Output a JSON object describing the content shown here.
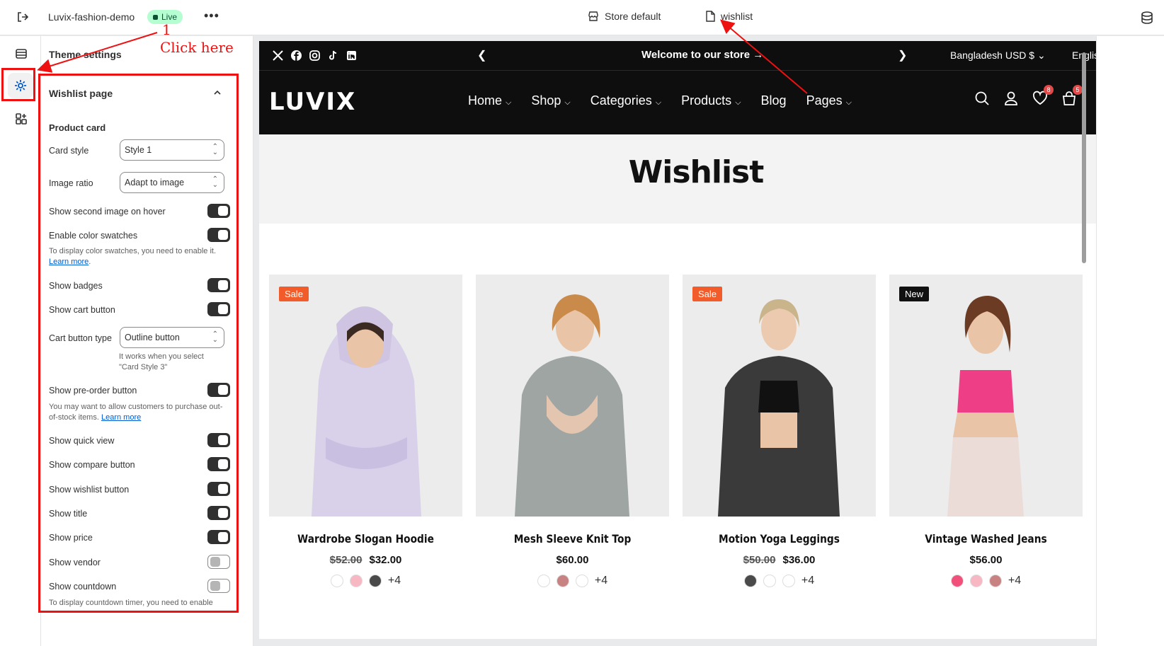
{
  "topbar": {
    "store_name": "Luvix-fashion-demo",
    "status_badge": "Live",
    "more_label": "•••",
    "theme_label": "Store default",
    "template_label": "wishlist"
  },
  "panel": {
    "title": "Theme settings",
    "section_title": "Wishlist page",
    "subsection_title": "Product card",
    "fields": [
      {
        "label": "Card style",
        "value": "Style 1"
      },
      {
        "label": "Image ratio",
        "value": "Adapt to image"
      },
      {
        "label": "Cart button type",
        "value": "Outline button"
      }
    ],
    "toggles": [
      {
        "label": "Show second image on hover",
        "on": true
      },
      {
        "label": "Enable color swatches",
        "on": true
      },
      {
        "label": "Show badges",
        "on": true
      },
      {
        "label": "Show cart button",
        "on": true
      },
      {
        "label": "Show pre-order button",
        "on": true
      },
      {
        "label": "Show quick view",
        "on": true
      },
      {
        "label": "Show compare button",
        "on": true
      },
      {
        "label": "Show wishlist button",
        "on": true
      },
      {
        "label": "Show title",
        "on": true
      },
      {
        "label": "Show price",
        "on": true
      },
      {
        "label": "Show vendor",
        "on": false
      },
      {
        "label": "Show countdown",
        "on": false
      }
    ],
    "help": {
      "swatches": "To display color swatches, you need to enable it.",
      "learn_more": "Learn more",
      "cart_type": "It works when you select \"Card Style 3\"",
      "preorder": "You may want to allow customers to purchase out-of-stock items.",
      "countdown": "To display countdown timer, you need to enable"
    }
  },
  "annotation": {
    "step_number": "1",
    "click_text": "Click here"
  },
  "store": {
    "announcement": "Welcome to our store →",
    "currency": "Bangladesh USD $ ⌄",
    "language": "English ⌄",
    "logo": "LUVIX",
    "nav": [
      "Home",
      "Shop",
      "Categories",
      "Products",
      "Blog",
      "Pages"
    ],
    "wishlist_count": "8",
    "cart_count": "5",
    "page_title": "Wishlist",
    "products": [
      {
        "name": "Wardrobe Slogan Hoodie",
        "compare_price": "$52.00",
        "price": "$32.00",
        "tag": "Sale",
        "tag_color": "#f25c2b",
        "swatches": [
          "#ffffff",
          "#f7b7c3",
          "#4a4a4a"
        ],
        "more": "+4"
      },
      {
        "name": "Mesh Sleeve Knit Top",
        "compare_price": "",
        "price": "$60.00",
        "tag": "",
        "tag_color": "",
        "swatches": [
          "#ffffff",
          "#c98282",
          "#ffffff"
        ],
        "more": "+4"
      },
      {
        "name": "Motion Yoga Leggings",
        "compare_price": "$50.00",
        "price": "$36.00",
        "tag": "Sale",
        "tag_color": "#f25c2b",
        "swatches": [
          "#4a4a4a",
          "#ffffff",
          "#ffffff"
        ],
        "more": "+4"
      },
      {
        "name": "Vintage Washed Jeans",
        "compare_price": "",
        "price": "$56.00",
        "tag": "New",
        "tag_color": "#111111",
        "swatches": [
          "#f0507a",
          "#f7b7c3",
          "#c98282"
        ],
        "more": "+4"
      }
    ]
  },
  "colors": {
    "accent_red": "#e11111",
    "live_badge_bg": "#b4fed2"
  }
}
